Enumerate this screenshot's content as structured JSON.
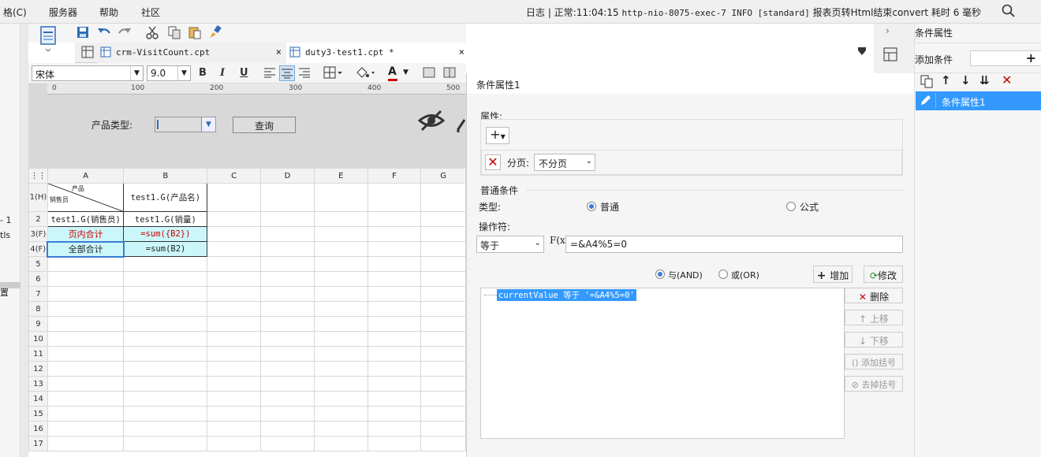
{
  "menubar": {
    "items": [
      "格(C)",
      "服务器",
      "帮助",
      "社区"
    ],
    "log_prefix": "日志 | 正常:11:04:15 ",
    "log_mono": "http-nio-8075-exec-7 INFO [standard]",
    "log_suffix": " 报表页转Html结束convert  耗时 6 毫秒"
  },
  "left": {
    "frag1": "- 1",
    "frag2": "tls",
    "frag3": "置"
  },
  "tabs": [
    {
      "label": "crm-VisitCount.cpt",
      "close": "×"
    },
    {
      "label": "duty3-test1.cpt *",
      "close": "×"
    }
  ],
  "format": {
    "font": "宋体",
    "size": "9.0",
    "bold": "B",
    "italic": "I",
    "underline": "U",
    "font_color_label": "A"
  },
  "ruler": {
    "ticks": [
      "0",
      "100",
      "200",
      "300",
      "400",
      "500"
    ]
  },
  "param": {
    "label": "产品类型:",
    "query": "查询"
  },
  "grid": {
    "cols": [
      "A",
      "B",
      "C",
      "D",
      "E",
      "F",
      "G"
    ],
    "rows": [
      {
        "h": "1(H)",
        "a_top": "产品",
        "a_bottom": "销售员",
        "b": "test1.G(产品名)"
      },
      {
        "h": "2",
        "a": "test1.G(销售员)",
        "b": "test1.G(销量)"
      },
      {
        "h": "3(F)",
        "a": "页内合计",
        "b": "=sum({B2})"
      },
      {
        "h": "4(F)",
        "a": "全部合计",
        "b": "=sum(B2)"
      }
    ],
    "empty_rows": [
      "5",
      "6",
      "7",
      "8",
      "9",
      "10",
      "11",
      "12",
      "13",
      "14",
      "15",
      "16",
      "17"
    ]
  },
  "dialog": {
    "title": "条件属性1",
    "property_label": "属性:",
    "paging_label": "分页:",
    "paging_value": "不分页",
    "normal_condition": "普通条件",
    "type_label": "类型:",
    "type_normal": "普通",
    "type_formula": "公式",
    "operator_label": "操作符:",
    "operator_value": "等于",
    "fx": "F(x)",
    "value": "=&A4%5=0",
    "and_label": "与(AND)",
    "or_label": "或(OR)",
    "add_label": "增加",
    "modify_label": "修改",
    "condition_item": "currentValue 等于 '=&A4%5=0'",
    "delete_label": "删除",
    "up_label": "上移",
    "down_label": "下移",
    "add_bracket": "添加括号",
    "remove_bracket": "去掉括号"
  },
  "rightpanel": {
    "title": "条件属性",
    "add_condition": "添加条件",
    "list_item": "条件属性1"
  },
  "colors": {
    "accent": "#3399ff",
    "selected_row": "#3399ff",
    "cyan_cell": "#ccf7fa",
    "red": "#cc0000"
  }
}
